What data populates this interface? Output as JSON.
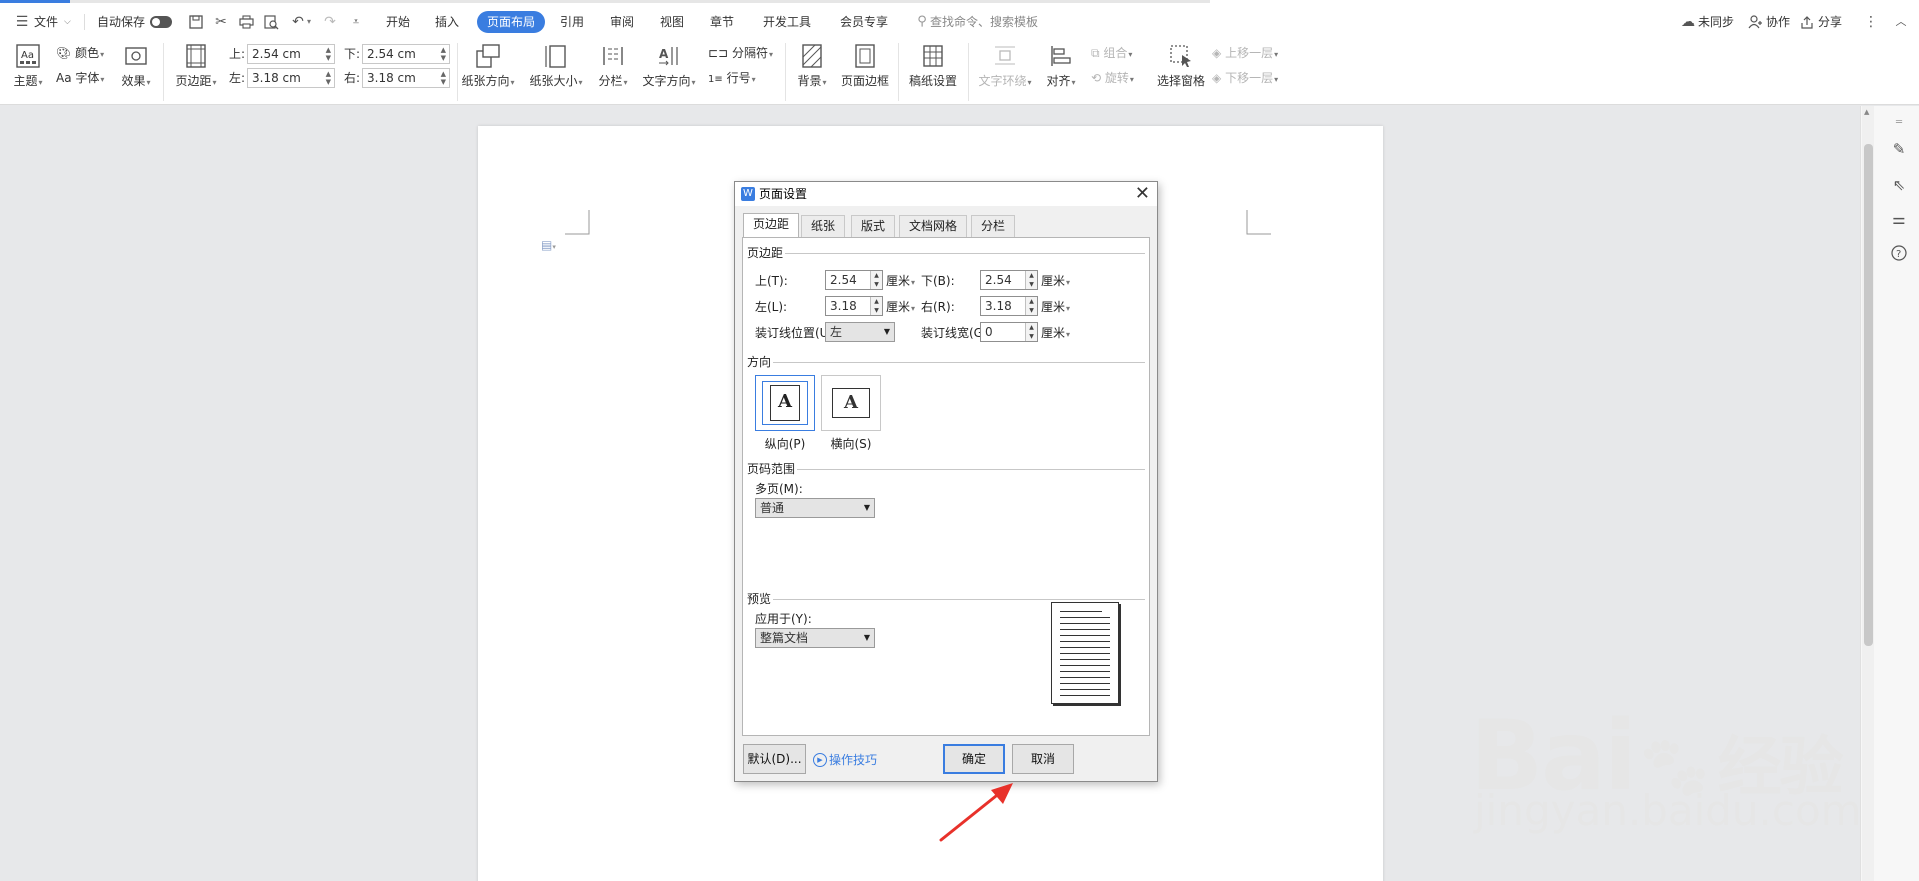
{
  "menu": {
    "file": "文件",
    "autosave": "自动保存",
    "tabs": [
      "开始",
      "插入",
      "页面布局",
      "引用",
      "审阅",
      "视图",
      "章节",
      "开发工具",
      "会员专享"
    ],
    "active_tab": "页面布局",
    "search": "查找命令、搜索模板",
    "sync": "未同步",
    "collab": "协作",
    "share": "分享"
  },
  "ribbon": {
    "theme": "主题",
    "color": "颜色",
    "font": "Aa 字体",
    "effect": "效果",
    "margins": "页边距",
    "top_label": "上:",
    "top_value": "2.54 cm",
    "bottom_label": "下:",
    "bottom_value": "2.54 cm",
    "left_label": "左:",
    "left_value": "3.18 cm",
    "right_label": "右:",
    "right_value": "3.18 cm",
    "orientation": "纸张方向",
    "size": "纸张大小",
    "columns": "分栏",
    "text_direction": "文字方向",
    "breaks": "分隔符",
    "line_numbers": "行号",
    "background": "背景",
    "page_border": "页面边框",
    "manuscript": "稿纸设置",
    "wrap_text": "文字环绕",
    "align": "对齐",
    "group": "组合",
    "rotate": "旋转",
    "selection_pane": "选择窗格",
    "bring_forward": "上移一层",
    "send_backward": "下移一层"
  },
  "dialog": {
    "title": "页面设置",
    "tabs": [
      "页边距",
      "纸张",
      "版式",
      "文档网格",
      "分栏"
    ],
    "active_tab": "页边距",
    "margins_group": "页边距",
    "top_label": "上(T):",
    "top_value": "2.54",
    "bottom_label": "下(B):",
    "bottom_value": "2.54",
    "left_label": "左(L):",
    "left_value": "3.18",
    "right_label": "右(R):",
    "right_value": "3.18",
    "unit": "厘米",
    "gutter_pos_label": "装订线位置(U):",
    "gutter_pos_value": "左",
    "gutter_label": "装订线宽(G):",
    "gutter_value": "0",
    "orientation_group": "方向",
    "portrait": "纵向(P)",
    "landscape": "横向(S)",
    "pages_group": "页码范围",
    "multi_label": "多页(M):",
    "multi_value": "普通",
    "preview_group": "预览",
    "apply_label": "应用于(Y):",
    "apply_value": "整篇文档",
    "default_button": "默认(D)...",
    "tips": "操作技巧",
    "ok": "确定",
    "cancel": "取消"
  },
  "watermark": {
    "brand": "Bai",
    "brand_cn": "经验",
    "url": "jingyan.baidu.com"
  },
  "colors": {
    "accent": "#3a7de0",
    "arrow": "#e8312a"
  }
}
